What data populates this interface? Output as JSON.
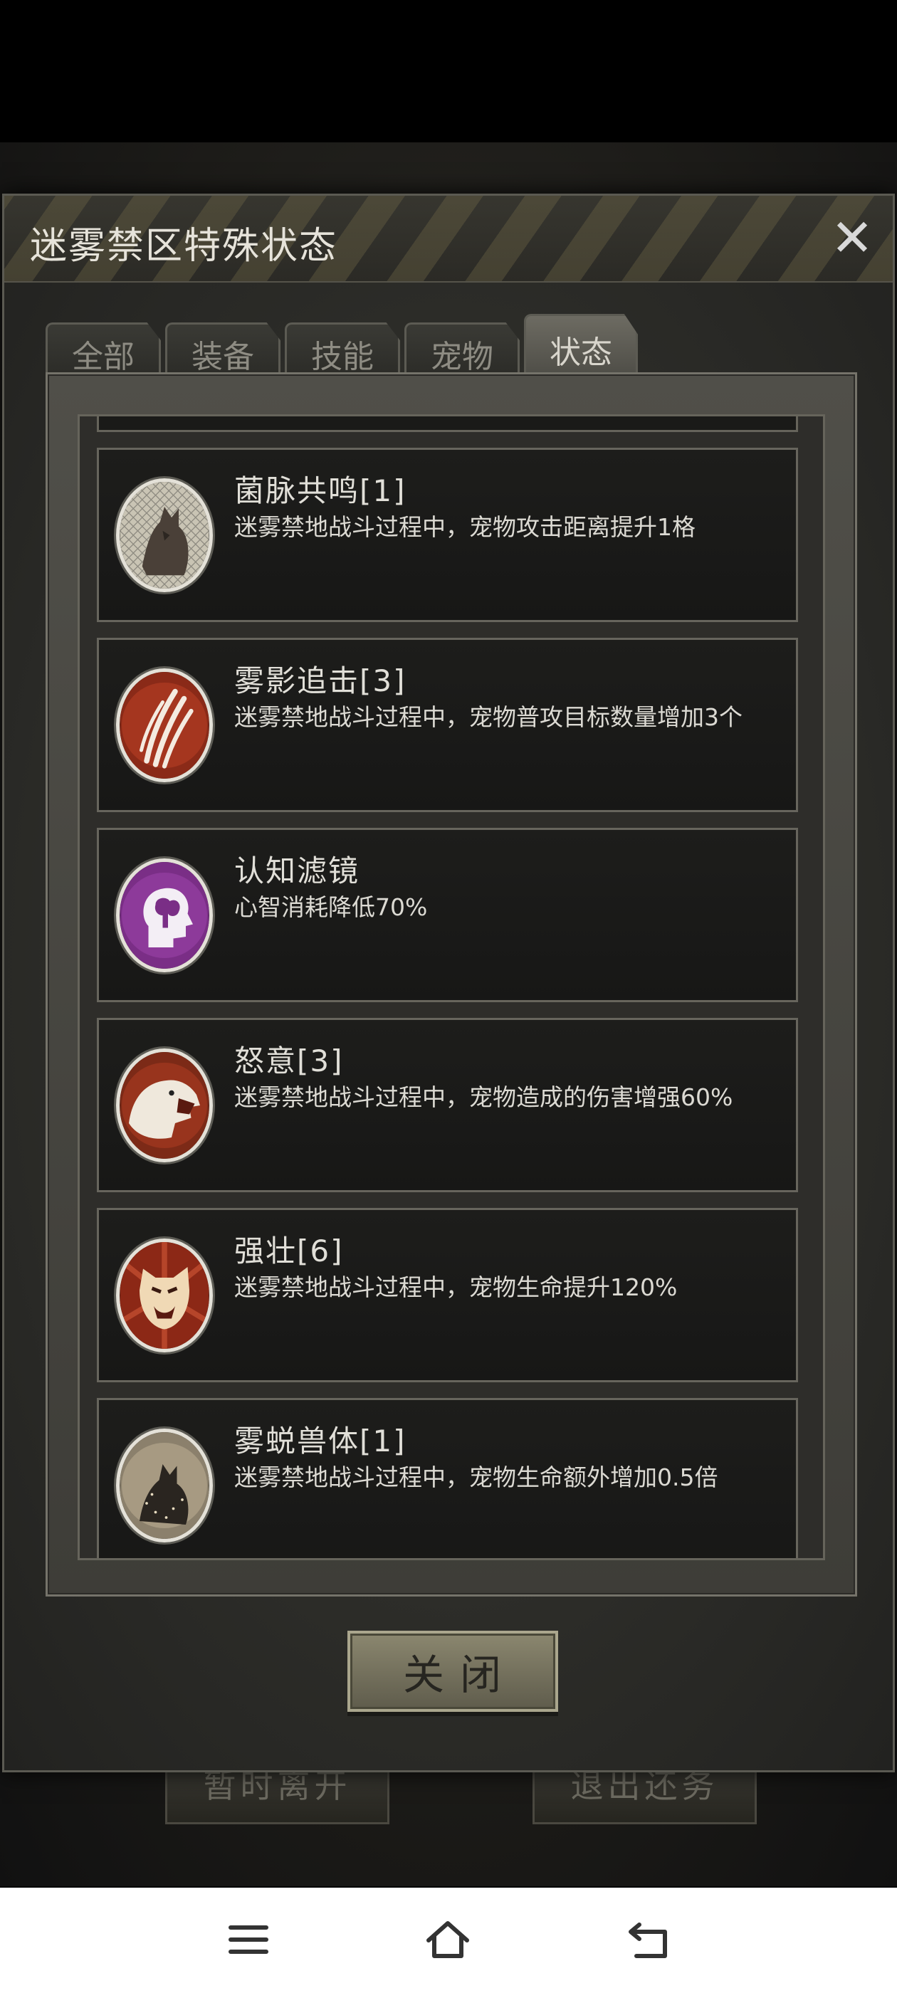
{
  "background": {
    "left_button": "暂时离开",
    "right_button": "退出还务"
  },
  "modal": {
    "title": "迷雾禁区特殊状态",
    "close_icon": "close-x-icon",
    "tabs": [
      {
        "label": "全部",
        "active": false
      },
      {
        "label": "装备",
        "active": false
      },
      {
        "label": "技能",
        "active": false
      },
      {
        "label": "宠物",
        "active": false
      },
      {
        "label": "状态",
        "active": true
      }
    ],
    "items": [
      {
        "icon": "wolf-web-icon",
        "name": "菌脉共鸣[1]",
        "desc": "迷雾禁地战斗过程中，宠物攻击距离提升1格"
      },
      {
        "icon": "claw-marks-icon",
        "name": "雾影追击[3]",
        "desc": "迷雾禁地战斗过程中，宠物普攻目标数量增加3个"
      },
      {
        "icon": "brain-head-icon",
        "name": "认知滤镜",
        "desc": "心智消耗降低70%"
      },
      {
        "icon": "roaring-bear-icon",
        "name": "怒意[3]",
        "desc": "迷雾禁地战斗过程中，宠物造成的伤害增强60%"
      },
      {
        "icon": "tiger-rage-icon",
        "name": "强壮[6]",
        "desc": "迷雾禁地战斗过程中，宠物生命提升120%"
      },
      {
        "icon": "misty-wolf-icon",
        "name": "雾蜕兽体[1]",
        "desc": "迷雾禁地战斗过程中，宠物生命额外增加0.5倍"
      }
    ],
    "close_button": "关闭"
  },
  "navbar": {
    "icons": [
      "menu-icon",
      "home-icon",
      "back-icon"
    ]
  }
}
